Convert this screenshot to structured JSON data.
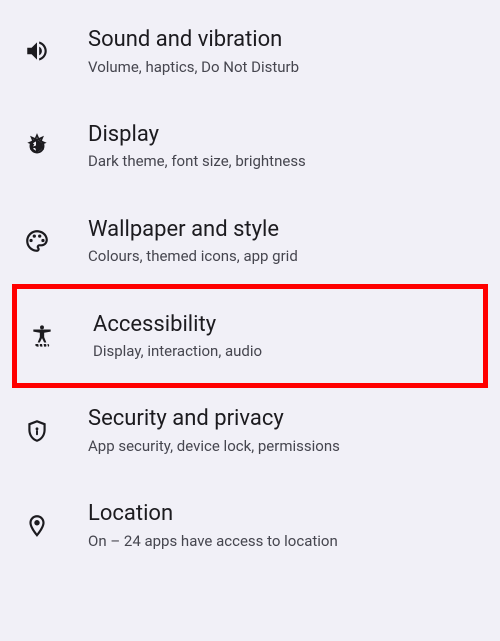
{
  "settings": {
    "items": [
      {
        "icon": "sound-icon",
        "title": "Sound and vibration",
        "subtitle": "Volume, haptics, Do Not Disturb",
        "highlighted": false
      },
      {
        "icon": "display-icon",
        "title": "Display",
        "subtitle": "Dark theme, font size, brightness",
        "highlighted": false
      },
      {
        "icon": "wallpaper-icon",
        "title": "Wallpaper and style",
        "subtitle": "Colours, themed icons, app grid",
        "highlighted": false
      },
      {
        "icon": "accessibility-icon",
        "title": "Accessibility",
        "subtitle": "Display, interaction, audio",
        "highlighted": true
      },
      {
        "icon": "security-icon",
        "title": "Security and privacy",
        "subtitle": "App security, device lock, permissions",
        "highlighted": false
      },
      {
        "icon": "location-icon",
        "title": "Location",
        "subtitle": "On – 24 apps have access to location",
        "highlighted": false
      }
    ]
  }
}
